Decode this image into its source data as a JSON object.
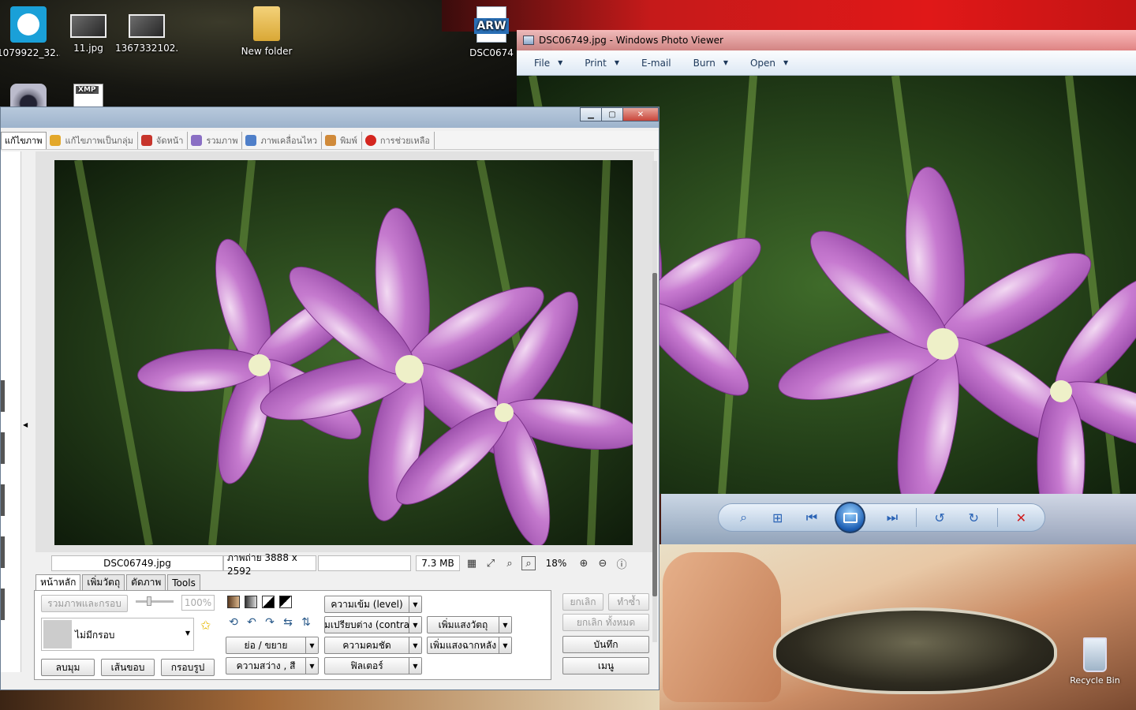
{
  "desktop": {
    "icons": [
      {
        "label": "1079922_32...",
        "icon": "app-icon"
      },
      {
        "label": "11.jpg",
        "icon": "image-file-icon"
      },
      {
        "label": "1367332102...",
        "icon": "image-file-icon"
      },
      {
        "label": "New folder",
        "icon": "folder-icon"
      },
      {
        "label": "DSC0674",
        "icon": "arw-file-icon",
        "badge": "ARW"
      },
      {
        "label": "",
        "icon": "camera-app-icon"
      },
      {
        "label": "",
        "icon": "xmp-file-icon",
        "badge": "XMP"
      }
    ],
    "recycle_bin": "Recycle Bin"
  },
  "photo_viewer": {
    "title": "DSC06749.jpg - Windows Photo Viewer",
    "menu": [
      "File",
      "Print",
      "E-mail",
      "Burn",
      "Open"
    ],
    "controls": [
      "zoom-icon",
      "actual-size-icon",
      "previous-icon",
      "slideshow-icon",
      "next-icon",
      "rotate-left-icon",
      "rotate-right-icon",
      "delete-icon"
    ]
  },
  "editor": {
    "tabs": [
      {
        "label": "แก้ไขภาพ",
        "active": true
      },
      {
        "label": "แก้ไขภาพเป็นกลุ่ม"
      },
      {
        "label": "จัดหน้า"
      },
      {
        "label": "รวมภาพ"
      },
      {
        "label": "ภาพเคลื่อนไหว"
      },
      {
        "label": "พิมพ์"
      },
      {
        "label": "การช่วยเหลือ"
      }
    ],
    "status": {
      "filename": "DSC06749.jpg",
      "dimensions": "ภาพถ่าย 3888 x 2592",
      "filesize": "7.3 MB",
      "zoom": "18%"
    },
    "subtabs": [
      "หน้าหลัก",
      "เพิ่มวัตถุ",
      "ตัดภาพ",
      "Tools"
    ],
    "panel": {
      "combine_frame": "รวมภาพและกรอบ",
      "opacity": "100%",
      "frame_select": "ไม่มีกรอบ",
      "round_corners": "ลบมุม",
      "border": "เส้นขอบ",
      "frame": "กรอบรูป",
      "resize": "ย่อ / ขยาย",
      "brightness": "ความสว่าง , สี",
      "level": "ความเข้ม (level)",
      "contrast": "มเปรียบต่าง (contra",
      "sharpness": "ความคมชัด",
      "filter": "ฟิลเตอร์",
      "add_light_object": "เพิ่มแสงวัตถุ",
      "add_light_bg": "เพิ่มแสงฉากหลัง"
    },
    "right_buttons": {
      "undo": "ยกเลิก",
      "redo": "ทำซ้ำ",
      "undo_all": "ยกเลิก ทั้งหมด",
      "save": "บันทึก",
      "menu": "เมนู"
    }
  }
}
